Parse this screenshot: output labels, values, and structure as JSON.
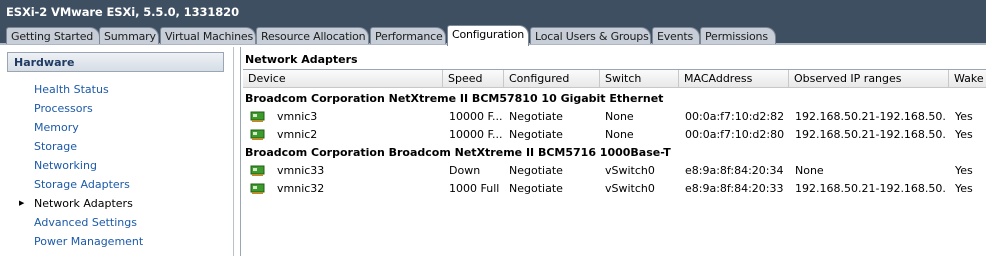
{
  "window": {
    "title": "ESXi-2 VMware ESXi, 5.5.0, 1331820"
  },
  "tabs": [
    {
      "label": "Getting Started"
    },
    {
      "label": "Summary"
    },
    {
      "label": "Virtual Machines"
    },
    {
      "label": "Resource Allocation"
    },
    {
      "label": "Performance"
    },
    {
      "label": "Configuration",
      "active": true
    },
    {
      "label": "Local Users & Groups"
    },
    {
      "label": "Events"
    },
    {
      "label": "Permissions"
    }
  ],
  "sidebar": {
    "header": "Hardware",
    "items": [
      {
        "label": "Health Status"
      },
      {
        "label": "Processors"
      },
      {
        "label": "Memory"
      },
      {
        "label": "Storage"
      },
      {
        "label": "Networking"
      },
      {
        "label": "Storage Adapters"
      },
      {
        "label": "Network Adapters",
        "selected": true
      },
      {
        "label": "Advanced Settings"
      },
      {
        "label": "Power Management"
      }
    ]
  },
  "main": {
    "title": "Network Adapters",
    "columns": [
      "Device",
      "Speed",
      "Configured",
      "Switch",
      "MACAddress",
      "Observed IP ranges",
      "Wake"
    ],
    "groups": [
      {
        "name": "Broadcom Corporation NetXtreme II BCM57810 10 Gigabit Ethernet",
        "rows": [
          {
            "device": "vmnic3",
            "speed": "10000 F...",
            "configured": "Negotiate",
            "switch": "None",
            "mac": "00:0a:f7:10:d2:82",
            "ip": "192.168.50.21-192.168.50...",
            "wake": "Yes"
          },
          {
            "device": "vmnic2",
            "speed": "10000 F...",
            "configured": "Negotiate",
            "switch": "None",
            "mac": "00:0a:f7:10:d2:80",
            "ip": "192.168.50.21-192.168.50...",
            "wake": "Yes"
          }
        ]
      },
      {
        "name": "Broadcom Corporation Broadcom NetXtreme II BCM5716 1000Base-T",
        "rows": [
          {
            "device": "vmnic33",
            "speed": "Down",
            "configured": "Negotiate",
            "switch": "vSwitch0",
            "mac": "e8:9a:8f:84:20:34",
            "ip": "None",
            "wake": "Yes"
          },
          {
            "device": "vmnic32",
            "speed": "1000 Full",
            "configured": "Negotiate",
            "switch": "vSwitch0",
            "mac": "e8:9a:8f:84:20:33",
            "ip": "192.168.50.21-192.168.50...",
            "wake": "Yes"
          }
        ]
      }
    ]
  },
  "icons": {
    "nic": "network-card-icon",
    "selection_arrow": "triangle-right-icon"
  },
  "colors": {
    "titlebar": "#3f4f62",
    "link": "#1c5aa8",
    "nic_icon": "#3d9a2d"
  }
}
